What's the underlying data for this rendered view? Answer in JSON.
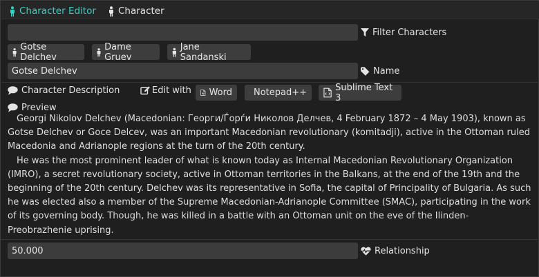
{
  "tabs": [
    {
      "label": "Character Editor",
      "icon": "person-icon",
      "active": true
    },
    {
      "label": "Character",
      "icon": "person-icon",
      "active": false
    }
  ],
  "filter": {
    "value": "",
    "label": "Filter Characters",
    "icon": "filter-icon"
  },
  "characters": [
    "Gotse Delchev",
    "Dame Gruev",
    "Jane Sandanski"
  ],
  "name": {
    "value": "Gotse Delchev",
    "label": "Name",
    "icon": "tag-icon"
  },
  "description": {
    "label": "Character Description",
    "edit_with_label": "Edit with",
    "editors": [
      "Word",
      "Notepad++",
      "Sublime Text 3"
    ]
  },
  "preview": {
    "label": "Preview",
    "paragraphs": [
      "Georgi Nikolov Delchev (Macedonian: Георги/Ѓорѓи Николов Делчев, 4 February 1872 – 4 May 1903), known as Gotse Delchev or Goce Delcev, was an important Macedonian revolutionary (komitadji), active in the Ottoman ruled Macedonia and Adrianople regions at the turn of the 20th century.",
      "He was the most prominent leader of what is known today as Internal Macedonian Revolutionary Organization (IMRO), a secret revolutionary society, active in Ottoman territories in the Balkans, at the end of the 19th and the beginning of the 20th century. Delchev was its representative in Sofia, the capital of Principality of Bulgaria. As such he was elected also a member of the Supreme Macedonian-Adrianople Committee (SMAC), participating in the work of its governing body. Though, he was killed in a battle with an Ottoman unit on the eve of the Ilinden-Preobrazhenie uprising."
    ]
  },
  "relationship": {
    "value": "50.000",
    "label": "Relationship",
    "icon": "heartbeat-icon"
  },
  "colors": {
    "accent": "#35d0c2",
    "background": "#1f1f1f",
    "field": "#3c3c3c"
  }
}
